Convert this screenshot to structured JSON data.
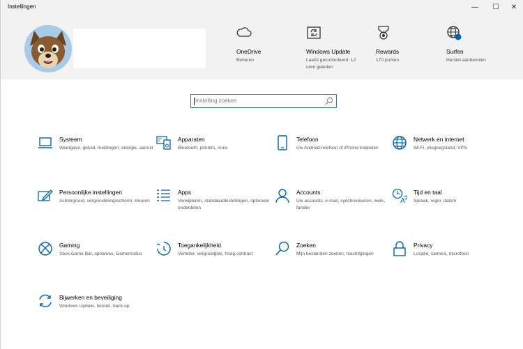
{
  "window": {
    "title": "Instellingen",
    "minimize_glyph": "—",
    "maximize_glyph": "☐",
    "close_glyph": "✕"
  },
  "hero": [
    {
      "title": "OneDrive",
      "subtitle": "Beheren",
      "icon": "cloud-icon"
    },
    {
      "title": "Windows Update",
      "subtitle": "Laatst gecontroleerd: 12 uren geleden",
      "icon": "windows-update-icon"
    },
    {
      "title": "Rewards",
      "subtitle": "170 punten",
      "icon": "medal-icon"
    },
    {
      "title": "Surfen",
      "subtitle": "Herstel aanbevolen",
      "icon": "globe-icon"
    }
  ],
  "search": {
    "placeholder": "Instelling zoeken"
  },
  "categories": [
    {
      "title": "Systeem",
      "desc": "Weergave, geluid, meldingen, energie, aan/uit",
      "icon": "laptop-icon"
    },
    {
      "title": "Apparaten",
      "desc": "Bluetooth, printers, muis",
      "icon": "devices-icon"
    },
    {
      "title": "Telefoon",
      "desc": "Uw Android-telefoon of iPhone koppelen",
      "icon": "phone-icon"
    },
    {
      "title": "Netwerk en internet",
      "desc": "Wi-Fi, vliegtuigstand, VPN",
      "icon": "globe-icon"
    },
    {
      "title": "Persoonlijke instellingen",
      "desc": "Achtergrond, vergrendelingsscherm, kleuren",
      "icon": "pen-screen-icon"
    },
    {
      "title": "Apps",
      "desc": "Verwijderen, standaardinstellingen, optionele onderdelen",
      "icon": "apps-list-icon"
    },
    {
      "title": "Accounts",
      "desc": "Uw accounts, e-mail, synchroniseren, werk, familie",
      "icon": "person-icon"
    },
    {
      "title": "Tijd en taal",
      "desc": "Spraak, regio, datum",
      "icon": "time-language-icon"
    },
    {
      "title": "Gaming",
      "desc": "Xbox Game Bar, opnames, Gamemodus",
      "icon": "xbox-icon"
    },
    {
      "title": "Toegankelijkheid",
      "desc": "Verteller, vergrootglas, hoog contrast",
      "icon": "ease-of-access-icon"
    },
    {
      "title": "Zoeken",
      "desc": "Mijn bestanden zoeken, machtigingen",
      "icon": "search-icon"
    },
    {
      "title": "Privacy",
      "desc": "Locatie, camera, microfoon",
      "icon": "lock-icon"
    },
    {
      "title": "Bijwerken en beveiliging",
      "desc": "Windows Update, herstel, back-up",
      "icon": "sync-icon"
    }
  ],
  "colors": {
    "accent": "#0063b1",
    "header_bg": "#f2f2f2",
    "search_border": "#3b78b5"
  }
}
